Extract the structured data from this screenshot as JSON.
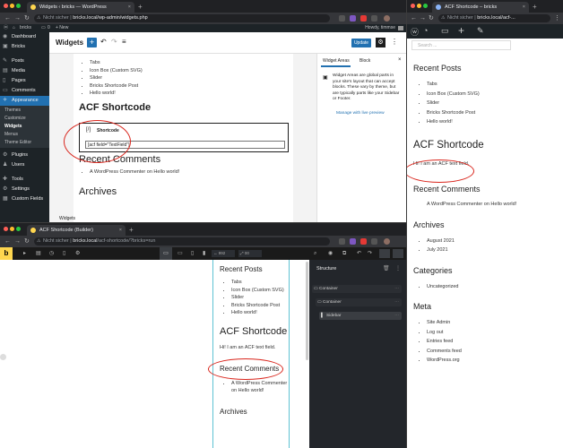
{
  "wp_window": {
    "tab_title": "Widgets ‹ bricks — WordPress",
    "url_prefix": "Nicht sicher",
    "url": "bricks.local/wp-admin/widgets.php",
    "admin_bar": {
      "site_name": "bricks",
      "comments": "0",
      "new": "+ New",
      "howdy": "Howdy, timmse"
    },
    "menu": [
      {
        "label": "Dashboard",
        "icon": "◉"
      },
      {
        "label": "Bricks",
        "icon": "▣"
      },
      {
        "label": "Posts",
        "icon": "✎"
      },
      {
        "label": "Media",
        "icon": "▤"
      },
      {
        "label": "Pages",
        "icon": "▯"
      },
      {
        "label": "Comments",
        "icon": "▭"
      },
      {
        "label": "Appearance",
        "icon": "✧"
      }
    ],
    "submenu": [
      "Themes",
      "Customize",
      "Widgets",
      "Menus",
      "Theme Editor"
    ],
    "menu2": [
      {
        "label": "Plugins",
        "icon": "⚙"
      },
      {
        "label": "Users",
        "icon": "♟"
      },
      {
        "label": "Tools",
        "icon": "✚"
      },
      {
        "label": "Settings",
        "icon": "⚙"
      },
      {
        "label": "Custom Fields",
        "icon": "▦"
      }
    ],
    "editor": {
      "title": "Widgets",
      "update": "Update",
      "list_items": [
        "Tabs",
        "Icon Box (Custom SVG)",
        "Slider",
        "Bricks Shortcode Post",
        "Hello world!"
      ],
      "acf_heading": "ACF Shortcode",
      "shortcode_label": "Shortcode",
      "shortcode_value": "[acf field=\"TextField\"]",
      "recent_comments_heading": "Recent Comments",
      "comment": "A WordPress Commenter on Hello world!",
      "archives_heading": "Archives",
      "footer_label": "Widgets"
    },
    "inspector": {
      "tab1": "Widget Areas",
      "tab2": "Block",
      "description": "Widget Areas are global parts in your site's layout that can accept blocks. These vary by theme, but are typically parts like your Sidebar or Footer.",
      "link": "Manage with live preview"
    }
  },
  "frontend_window": {
    "tab_title": "ACF Shortcode – bricks",
    "url_prefix": "Nicht sicher",
    "url": "bricks.local/acf-...",
    "search_placeholder": "Search ...",
    "recent_posts_heading": "Recent Posts",
    "posts": [
      "Tabs",
      "Icon Box (Custom SVG)",
      "Slider",
      "Bricks Shortcode Post",
      "Hello world!"
    ],
    "acf_heading": "ACF Shortcode",
    "acf_text": "Hi! I am an ACF text field.",
    "recent_comments_heading": "Recent Comments",
    "comment": "A WordPress Commenter on Hello world!",
    "archives_heading": "Archives",
    "archives": [
      "August 2021",
      "July 2021"
    ],
    "categories_heading": "Categories",
    "categories": [
      "Uncategorized"
    ],
    "meta_heading": "Meta",
    "meta": [
      "Site Admin",
      "Log out",
      "Entries feed",
      "Comments feed",
      "WordPress.org"
    ]
  },
  "builder_window": {
    "tab_title": "ACF Shortcode (Builder)",
    "url_prefix": "Nicht sicher",
    "url_host": "bricks.local",
    "url_path": "/acf-shortcode/?bricks=run",
    "width_value": "992",
    "scale_value": "00",
    "recent_posts_heading": "Recent Posts",
    "posts": [
      "Tabs",
      "Icon Box (Custom SVG)",
      "Slider",
      "Bricks Shortcode Post",
      "Hello world!"
    ],
    "acf_heading": "ACF Shortcode",
    "acf_text": "Hi! I am an ACF text field.",
    "recent_comments_heading": "Recent Comments",
    "comment": "A WordPress Commenter on Hello world!",
    "archives_heading": "Archives",
    "structure_title": "Structure",
    "structure_items": [
      "Container",
      "Container",
      "Sidebar"
    ]
  },
  "colors": {
    "wp_blue": "#2271b1",
    "bricks_yellow": "#ffd64f",
    "highlight_red": "#d9251c"
  }
}
